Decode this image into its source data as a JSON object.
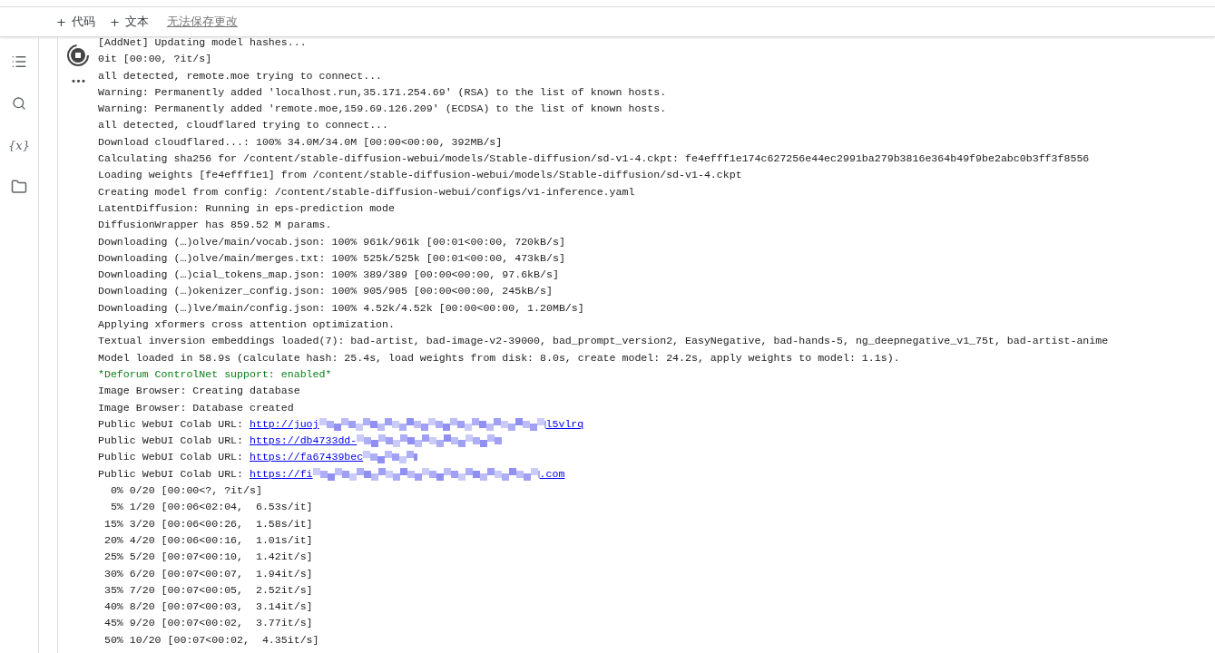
{
  "toolbar": {
    "buttons": [
      {
        "icon": "+",
        "label": "代码"
      },
      {
        "icon": "+",
        "label": "文本"
      }
    ],
    "save_status": "无法保存更改"
  },
  "sidebar": {
    "items": [
      {
        "kind": "toc"
      },
      {
        "kind": "search"
      },
      {
        "kind": "variables",
        "label": "{x}"
      },
      {
        "kind": "files"
      }
    ]
  },
  "cell": {
    "running": true,
    "more": "•••",
    "output": [
      {
        "kind": "text",
        "text": "[AddNet] Updating model hashes..."
      },
      {
        "kind": "text",
        "text": "0it [00:00, ?it/s]"
      },
      {
        "kind": "text",
        "text": "all detected, remote.moe trying to connect..."
      },
      {
        "kind": "text",
        "text": "Warning: Permanently added 'localhost.run,35.171.254.69' (RSA) to the list of known hosts."
      },
      {
        "kind": "text",
        "text": "Warning: Permanently added 'remote.moe,159.69.126.209' (ECDSA) to the list of known hosts."
      },
      {
        "kind": "text",
        "text": "all detected, cloudflared trying to connect..."
      },
      {
        "kind": "text",
        "text": "Download cloudflared...: 100% 34.0M/34.0M [00:00<00:00, 392MB/s]"
      },
      {
        "kind": "text",
        "text": "Calculating sha256 for /content/stable-diffusion-webui/models/Stable-diffusion/sd-v1-4.ckpt: fe4efff1e174c627256e44ec2991ba279b3816e364b49f9be2abc0b3ff3f8556"
      },
      {
        "kind": "text",
        "text": "Loading weights [fe4efff1e1] from /content/stable-diffusion-webui/models/Stable-diffusion/sd-v1-4.ckpt"
      },
      {
        "kind": "text",
        "text": "Creating model from config: /content/stable-diffusion-webui/configs/v1-inference.yaml"
      },
      {
        "kind": "text",
        "text": "LatentDiffusion: Running in eps-prediction mode"
      },
      {
        "kind": "text",
        "text": "DiffusionWrapper has 859.52 M params."
      },
      {
        "kind": "text",
        "text": "Downloading (…)olve/main/vocab.json: 100% 961k/961k [00:01<00:00, 720kB/s]"
      },
      {
        "kind": "text",
        "text": "Downloading (…)olve/main/merges.txt: 100% 525k/525k [00:01<00:00, 473kB/s]"
      },
      {
        "kind": "text",
        "text": "Downloading (…)cial_tokens_map.json: 100% 389/389 [00:00<00:00, 97.6kB/s]"
      },
      {
        "kind": "text",
        "text": "Downloading (…)okenizer_config.json: 100% 905/905 [00:00<00:00, 245kB/s]"
      },
      {
        "kind": "text",
        "text": "Downloading (…)lve/main/config.json: 100% 4.52k/4.52k [00:00<00:00, 1.20MB/s]"
      },
      {
        "kind": "text",
        "text": "Applying xformers cross attention optimization."
      },
      {
        "kind": "text",
        "text": "Textual inversion embeddings loaded(7): bad-artist, bad-image-v2-39000, bad_prompt_version2, EasyNegative, bad-hands-5, ng_deepnegative_v1_75t, bad-artist-anime"
      },
      {
        "kind": "text",
        "text": "Model loaded in 58.9s (calculate hash: 25.4s, load weights from disk: 8.0s, create model: 24.2s, apply weights to model: 1.1s)."
      },
      {
        "kind": "notice",
        "text": "*Deforum ControlNet support: enabled*"
      },
      {
        "kind": "text",
        "text": "Image Browser: Creating database"
      },
      {
        "kind": "text",
        "text": "Image Browser: Database created"
      },
      {
        "kind": "url",
        "text": "Public WebUI Colab URL:",
        "link": "http://juoj",
        "link_end": "l5vlrq"
      },
      {
        "kind": "url",
        "text": "Public WebUI Colab URL:",
        "link": "https://db4733dd-"
      },
      {
        "kind": "url",
        "text": "Public WebUI Colab URL:",
        "link": "https://fa67439bec"
      },
      {
        "kind": "url",
        "text": "Public WebUI Colab URL:",
        "link": "https://fi",
        "link_end": ".com"
      },
      {
        "kind": "text",
        "text": "  0% 0/20 [00:00<?, ?it/s]"
      },
      {
        "kind": "text",
        "text": "  5% 1/20 [00:06<02:04,  6.53s/it]"
      },
      {
        "kind": "text",
        "text": " 15% 3/20 [00:06<00:26,  1.58s/it]"
      },
      {
        "kind": "text",
        "text": " 20% 4/20 [00:06<00:16,  1.01s/it]"
      },
      {
        "kind": "text",
        "text": " 25% 5/20 [00:07<00:10,  1.42it/s]"
      },
      {
        "kind": "text",
        "text": " 30% 6/20 [00:07<00:07,  1.94it/s]"
      },
      {
        "kind": "text",
        "text": " 35% 7/20 [00:07<00:05,  2.52it/s]"
      },
      {
        "kind": "text",
        "text": " 40% 8/20 [00:07<00:03,  3.14it/s]"
      },
      {
        "kind": "text",
        "text": " 45% 9/20 [00:07<00:02,  3.77it/s]"
      },
      {
        "kind": "text",
        "text": " 50% 10/20 [00:07<00:02,  4.35it/s]"
      }
    ]
  }
}
